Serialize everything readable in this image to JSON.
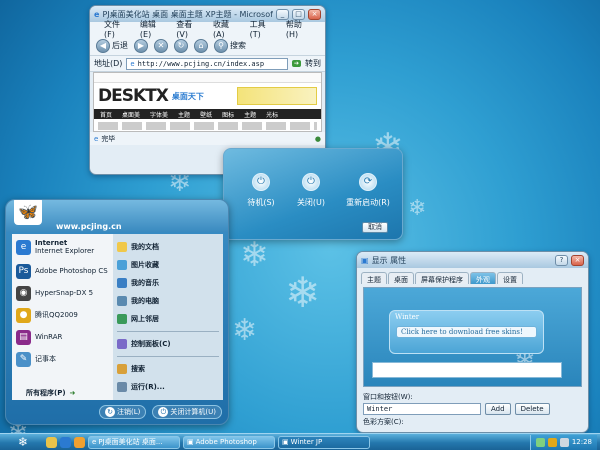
{
  "browser": {
    "title": "PJ桌面美化站 桌面 桌面主题 XP主题 - Microsoft Internet Explorer",
    "menu": [
      "文件(F)",
      "编辑(E)",
      "查看(V)",
      "收藏(A)",
      "工具(T)",
      "帮助(H)"
    ],
    "back_label": "后退",
    "search_label": "搜索",
    "address_label": "地址(D)",
    "address_value": "http://www.pcjing.cn/index.asp",
    "go_label": "转到",
    "status_text": "完毕",
    "page": {
      "logo": "DESKTX",
      "logo_sub": "桌面天下",
      "nav": [
        "首页",
        "桌面美",
        "字体美",
        "主题",
        "壁纸",
        "图标",
        "主题",
        "光标"
      ]
    }
  },
  "shutdown": {
    "standby": "待机(S)",
    "shutdown": "关闭(U)",
    "restart": "重新启动(R)",
    "cancel": "取消"
  },
  "start_menu": {
    "username": "www.pcjing.cn",
    "pinned": [
      {
        "title": "Internet",
        "subtitle": "Internet Explorer",
        "icon": "ie-icon",
        "color": "#2b7ad1"
      },
      {
        "title": "Adobe Photoshop CS",
        "subtitle": "",
        "icon": "photoshop-icon",
        "color": "#1a5a9a"
      },
      {
        "title": "HyperSnap-DX 5",
        "subtitle": "",
        "icon": "hypersnap-icon",
        "color": "#444444"
      },
      {
        "title": "腾讯QQ2009",
        "subtitle": "",
        "icon": "qq-icon",
        "color": "#e0a81a"
      },
      {
        "title": "WinRAR",
        "subtitle": "",
        "icon": "winrar-icon",
        "color": "#8a2a8a"
      },
      {
        "title": "记事本",
        "subtitle": "",
        "icon": "notepad-icon",
        "color": "#4a90c8"
      }
    ],
    "all_programs": "所有程序(P)",
    "places": [
      "我的文档",
      "图片收藏",
      "我的音乐",
      "我的电脑",
      "网上邻居"
    ],
    "system": [
      "控制面板(C)",
      "搜索",
      "运行(R)..."
    ],
    "logoff": "注销(L)",
    "turnoff": "关闭计算机(U)"
  },
  "properties": {
    "title": "显示 属性",
    "tabs": [
      "主题",
      "桌面",
      "屏幕保护程序",
      "外观",
      "设置"
    ],
    "active_tab": 3,
    "preview_title": "Winter",
    "preview_link": "Click here to download free skins!",
    "windows_label": "窗口和按钮(W):",
    "windows_value": "Winter",
    "add_button": "Add",
    "delete_button": "Delete",
    "color_label": "色彩方案(C):"
  },
  "taskbar": {
    "tasks": [
      "PJ桌面美化站 桌面...",
      "Adobe Photoshop",
      "Winter JP"
    ],
    "clock": "12:28"
  }
}
